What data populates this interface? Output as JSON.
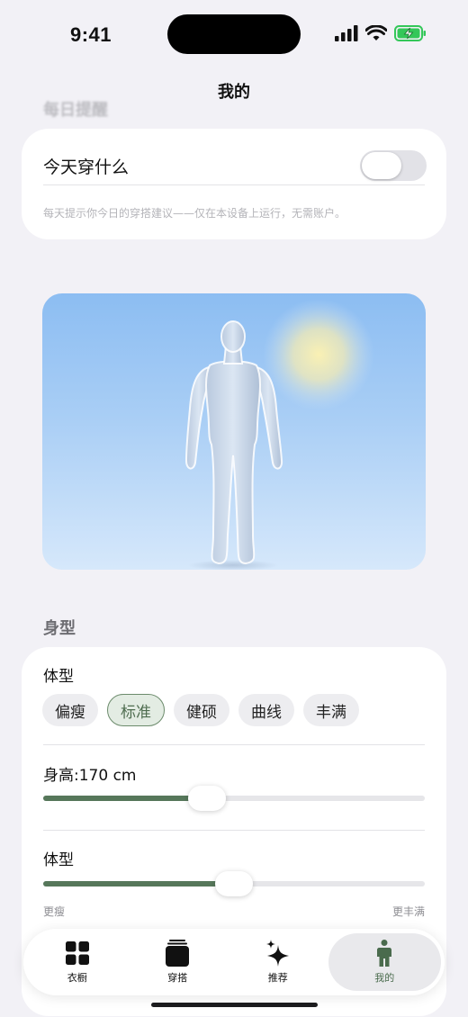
{
  "status": {
    "time": "9:41"
  },
  "nav": {
    "title": "我的"
  },
  "reminder": {
    "section_title": "每日提醒",
    "label": "今天穿什么",
    "enabled": false,
    "note": "每天提示你今日的穿搭建议——仅在本设备上运行，无需账户。"
  },
  "body": {
    "section_title": "身型",
    "type_label": "体型",
    "options": [
      "偏瘦",
      "标准",
      "健硕",
      "曲线",
      "丰满"
    ],
    "selected_option": "标准",
    "height_label": "身高:170 cm",
    "height_fraction": 0.43,
    "shape_label": "体型",
    "shape_fraction": 0.5,
    "shape_min": "更瘦",
    "shape_max": "更丰满"
  },
  "tabs": [
    {
      "label": "衣橱",
      "icon": "grid-icon"
    },
    {
      "label": "穿搭",
      "icon": "outfit-stack-icon"
    },
    {
      "label": "推荐",
      "icon": "sparkles-icon"
    },
    {
      "label": "我的",
      "icon": "person-icon",
      "active": true
    }
  ],
  "colors": {
    "accent": "#56775a",
    "background": "#f2f1f6",
    "sky": "#8cbdf2"
  }
}
